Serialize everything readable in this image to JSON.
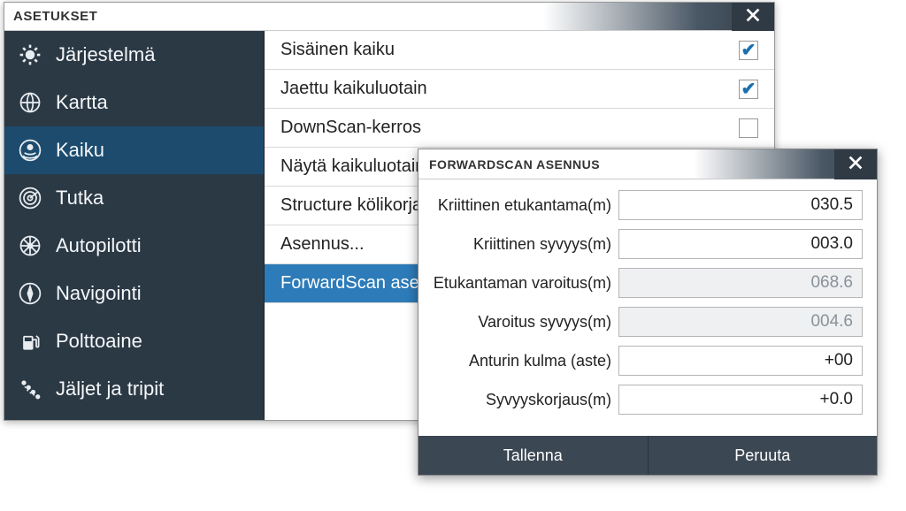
{
  "settings": {
    "title": "ASETUKSET",
    "sidebar": [
      {
        "label": "Järjestelmä",
        "icon": "gear"
      },
      {
        "label": "Kartta",
        "icon": "globe"
      },
      {
        "label": "Kaiku",
        "icon": "sonar",
        "selected": true
      },
      {
        "label": "Tutka",
        "icon": "radar"
      },
      {
        "label": "Autopilotti",
        "icon": "wheel"
      },
      {
        "label": "Navigointi",
        "icon": "compass"
      },
      {
        "label": "Polttoaine",
        "icon": "fuel"
      },
      {
        "label": "Jäljet ja tripit",
        "icon": "tracks"
      }
    ],
    "rows": [
      {
        "label": "Sisäinen kaiku",
        "type": "checkbox",
        "checked": true
      },
      {
        "label": "Jaettu kaikuluotain",
        "type": "checkbox",
        "checked": true
      },
      {
        "label": "DownScan-kerros",
        "type": "checkbox",
        "checked": false
      },
      {
        "label": "Näytä kaikuluotain",
        "type": "nav"
      },
      {
        "label": "Structure kölikorjaus",
        "type": "nav"
      },
      {
        "label": "Asennus...",
        "type": "nav"
      },
      {
        "label": "ForwardScan asennus",
        "type": "nav",
        "selected": true
      }
    ]
  },
  "fsDialog": {
    "title": "FORWARDSCAN ASENNUS",
    "fields": [
      {
        "label": "Kriittinen etukantama(m)",
        "value": "030.5",
        "disabled": false
      },
      {
        "label": "Kriittinen syvyys(m)",
        "value": "003.0",
        "disabled": false
      },
      {
        "label": "Etukantaman varoitus(m)",
        "value": "068.6",
        "disabled": true
      },
      {
        "label": "Varoitus syvyys(m)",
        "value": "004.6",
        "disabled": true
      },
      {
        "label": "Anturin kulma (aste)",
        "value": "+00",
        "disabled": false
      },
      {
        "label": "Syvyyskorjaus(m)",
        "value": "+0.0",
        "disabled": false
      }
    ],
    "buttons": {
      "save": "Tallenna",
      "cancel": "Peruuta"
    }
  }
}
